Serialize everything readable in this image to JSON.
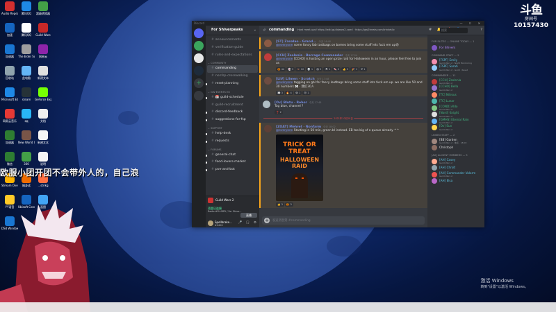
{
  "desktop": {
    "icons": [
      {
        "label": "Audio Repeat...",
        "color": "#d32f2f"
      },
      {
        "label": "腾讯QQ",
        "color": "#1e88e5"
      },
      {
        "label": "超级转换器",
        "color": "#43a047"
      },
      {
        "label": "加速",
        "color": "#1565c0"
      },
      {
        "label": "腾讯QQ",
        "color": "#ffffff"
      },
      {
        "label": "Guild Wars",
        "color": "#c62828"
      },
      {
        "label": "加速器",
        "color": "#1976d2"
      },
      {
        "label": "The Elder Scrolls",
        "color": "#9e9e9e"
      },
      {
        "label": "网易云",
        "color": "#8e24aa"
      },
      {
        "label": "回收站",
        "color": "#90a4ae"
      },
      {
        "label": "此电脑",
        "color": "#64b5f6"
      },
      {
        "label": "新建文本",
        "color": "#e0e0e0"
      },
      {
        "label": "Microsoft Edge",
        "color": "#1e88e5"
      },
      {
        "label": "steam",
        "color": "#263238"
      },
      {
        "label": "GeForce Experience",
        "color": "#76ff03"
      },
      {
        "label": "网易云音乐",
        "color": "#e53935"
      },
      {
        "label": "qq",
        "color": "#29b6f6"
      },
      {
        "label": "文档",
        "color": "#eeeeee"
      },
      {
        "label": "加速器",
        "color": "#2e7d32"
      },
      {
        "label": "New World Closed Beta",
        "color": "#795548"
      },
      {
        "label": "新建文本",
        "color": "#f5f5f5"
      },
      {
        "label": "微信",
        "color": "#2e7d32"
      },
      {
        "label": "360",
        "color": "#43a047"
      },
      {
        "label": "说明",
        "color": "#f5f5f5"
      },
      {
        "label": "Stream Overla...",
        "color": "#ffb300"
      },
      {
        "label": "随身读",
        "color": "#ef6c00"
      },
      {
        "label": "...strikg",
        "color": "#ff7043"
      },
      {
        "label": "YY语音",
        "color": "#ffca28"
      },
      {
        "label": "Ubisoft Connect",
        "color": "#1565c0"
      },
      {
        "label": "画图",
        "color": "#42a5f5"
      },
      {
        "label": "DS4 Windows",
        "color": "#1976d2"
      }
    ]
  },
  "overlay": {
    "watermark_logo": "斗鱼",
    "watermark_sub": "房间号",
    "room_number": "10157430",
    "subtitle": "欧服小团开团不会带外人的，自己浪",
    "win_activate": "激活 Windows",
    "win_activate_sub": "转到\"设置\"以激活 Windows。"
  },
  "discord": {
    "titlebar": "Discord",
    "window_controls": "— ☐ ✕",
    "server_name": "For Shiverpeaks",
    "channels": [
      {
        "type": "ch",
        "icon": "#",
        "name": "announcements",
        "state": ""
      },
      {
        "type": "ch",
        "icon": "#",
        "name": "verification-guide",
        "state": ""
      },
      {
        "type": "ch",
        "icon": "#",
        "name": "rules-and-expectations",
        "state": ""
      },
      {
        "type": "cat",
        "name": "⌄ Community"
      },
      {
        "type": "ch",
        "icon": "#",
        "name": "commanding",
        "state": "active"
      },
      {
        "type": "ch",
        "icon": "#",
        "name": "nonfsp-crosswalking",
        "state": ""
      },
      {
        "type": "ch",
        "icon": "#",
        "name": "reset-planning",
        "state": "unread"
      },
      {
        "type": "cat",
        "name": "⌄ GW Events EU"
      },
      {
        "type": "ch",
        "icon": "#",
        "name": "📅 guild-schedule",
        "state": "unread"
      },
      {
        "type": "ch",
        "icon": "#",
        "name": "guild-recruitment",
        "state": ""
      },
      {
        "type": "ch",
        "icon": "#",
        "name": "discord-feedback",
        "state": "unread"
      },
      {
        "type": "ch",
        "icon": "#",
        "name": "suggestions-for-fsp",
        "state": "unread"
      },
      {
        "type": "cat",
        "name": "⌄ Support"
      },
      {
        "type": "ch",
        "icon": "#",
        "name": "help-desk",
        "state": "unread"
      },
      {
        "type": "ch",
        "icon": "#",
        "name": "requests",
        "state": "unread"
      },
      {
        "type": "cat",
        "name": "⌄ Forums"
      },
      {
        "type": "ch",
        "icon": "#",
        "name": "general-chat",
        "state": "unread"
      },
      {
        "type": "ch",
        "icon": "#",
        "name": "food-lovers-market",
        "state": "unread"
      },
      {
        "type": "ch",
        "icon": "#",
        "name": "pve-and-bot",
        "state": "unread"
      }
    ],
    "voice": {
      "game": "Guild Wars 2",
      "connected": "语音已连接",
      "server": "Radio #FLURRY / For Shive...",
      "live": "直播"
    },
    "user": {
      "name": "Spellbrake...",
      "tag": "#0426",
      "controls": "🎤 🎧 ⚙"
    },
    "chat": {
      "channel": "commanding",
      "topic": "Host meet-ups! https://wiki.guildwars2.com/ · https://gw2treats.com/trinket/icon",
      "header_icons": "# 🔔 📌 👤",
      "search": "搜索",
      "input_placeholder": "发送消息到 #commanding",
      "divider": "2021年10月29日",
      "messages": [
        {
          "name": "[ST] Zaxalao · Grand...",
          "time": "今天 16:40",
          "ping": "@everyone",
          "body": " some fancy lbb tastbags on bomes bring some stuff lets fuck em up😄",
          "avatar": "#8a5a44",
          "mention": true,
          "reacts": []
        },
        {
          "name": "[CCH] Zsolenia · Barrage Commander",
          "time": "今天 17:24",
          "ping": "@everyone",
          "body": " [CCHO] is hosting an open prize raid for Halloween in an hour, please feel free to join us",
          "avatar": "#c13c3c",
          "mention": true,
          "reacts": [
            "🎃 44",
            "👻 3",
            "🦇 12",
            "💀 1",
            "😱 2",
            "🕷 1",
            "🍬 2",
            "👍 2",
            "🎉 1",
            "❤ 1"
          ]
        },
        {
          "name": "[LIV] Lilmen · Scratch",
          "time": "今天 17:48",
          "ping": "@everyone",
          "body": " tagging on gbl for fancy lootbags bring some stuff lets fuck em up. we are like 50 and 30 numbers 👀 · 我们30人",
          "avatar": "#6d4c41",
          "mention": true,
          "reacts": [
            "👀 3",
            "🔥 4",
            "😂 1",
            "😄 1"
          ]
        },
        {
          "name": "[Ov] Blutu · Rehor",
          "time": "今天 17:48",
          "ping": "",
          "body": "Tag blue, channel ?",
          "avatar": "#b0bec5",
          "mention": false,
          "reacts": [
            "❓ 2"
          ]
        },
        {
          "name": "[ZOAT] Mehret · Nonfarm",
          "time": "今天 18:02",
          "ping": "@everyone",
          "body": " Starting in 50 min, green bl instead. EB too big of a queue already ^^",
          "avatar": "#5d4037",
          "mention": true,
          "reacts": [
            "👍 3",
            "🎃 3"
          ]
        }
      ],
      "poster": {
        "line1": "TRICK OR TREAT",
        "line2": "HALLOWEEN RAID"
      }
    },
    "members": [
      {
        "type": "cat",
        "label": "FOR ELITES — ONLINE TODAY — 1"
      },
      {
        "type": "mem",
        "name": "For Shivers",
        "status": "",
        "color": "#b98bff",
        "avatar": "#7e57c2"
      },
      {
        "type": "cat",
        "label": "COMMAND STAFF — 5"
      },
      {
        "type": "mem",
        "name": "[FSPF] Emily",
        "status": "Guild Wars 2 · Night Monitoring",
        "color": "#5bc0de",
        "avatar": "#f48fb1"
      },
      {
        "type": "mem",
        "name": "[FSPF] Sarah",
        "status": "Guild Wars 2 · Guild · Reset",
        "color": "#5bc0de",
        "avatar": "#90caf9"
      },
      {
        "type": "cat",
        "label": "COMMANDER — 11"
      },
      {
        "type": "mem",
        "name": "[CCH] Zsolenia",
        "status": "Guild Wars 2",
        "color": "#43b581",
        "avatar": "#c13c3c"
      },
      {
        "type": "mem",
        "name": "[CCHO] Bella",
        "status": "Guild Wars 2",
        "color": "#43b581",
        "avatar": "#9575cd"
      },
      {
        "type": "mem",
        "name": "[TC] Nitrous",
        "status": "",
        "color": "#43b581",
        "avatar": "#ff8a65"
      },
      {
        "type": "mem",
        "name": "[TC] Lunar",
        "status": "",
        "color": "#43b581",
        "avatar": "#4db6ac"
      },
      {
        "type": "mem",
        "name": "[COND] Aldo",
        "status": "Guild Wars 2",
        "color": "#43b581",
        "avatar": "#81c784"
      },
      {
        "type": "mem",
        "name": "[Nord] Knight",
        "status": "Guild Wars 2",
        "color": "#43b581",
        "avatar": "#e0e0e0"
      },
      {
        "type": "mem",
        "name": "[GMHS] Eternal Rain",
        "status": "Guild Wars 2",
        "color": "#43b581",
        "avatar": "#64b5f6"
      },
      {
        "type": "mem",
        "name": "[Ov] Sun",
        "status": "Guild Wars 2",
        "color": "#43b581",
        "avatar": "#ffd54f"
      },
      {
        "type": "cat",
        "label": "LINKED STAFF — 2"
      },
      {
        "type": "mem",
        "name": "[BB] Garden",
        "status": "Guild Wars 2 · 地点 · 18:03",
        "color": "#dcddde",
        "avatar": "#a1887f"
      },
      {
        "type": "mem",
        "name": "Christoph",
        "status": "",
        "color": "#dcddde",
        "avatar": "#8d6e63"
      },
      {
        "type": "cat",
        "label": "[AX] ALIGENT MEMBERS — 5"
      },
      {
        "type": "mem",
        "name": "[AH] Casey",
        "status": "Guild Wars 2",
        "color": "#5bc0de",
        "avatar": "#ffab91"
      },
      {
        "type": "mem",
        "name": "[AH] Chrolt",
        "status": "",
        "color": "#5bc0de",
        "avatar": "#90a4ae"
      },
      {
        "type": "mem",
        "name": "[AH] Commander Valorm",
        "status": "Guild Wars 2",
        "color": "#5bc0de",
        "avatar": "#ef5350"
      },
      {
        "type": "mem",
        "name": "[AH] Elsa",
        "status": "",
        "color": "#5bc0de",
        "avatar": "#ba68c8"
      }
    ]
  }
}
